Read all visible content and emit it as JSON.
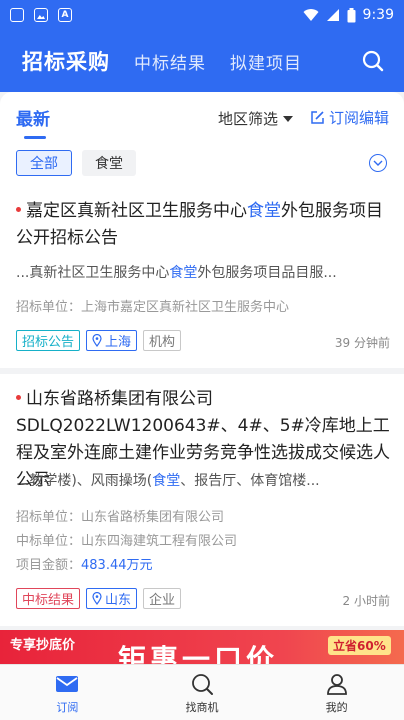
{
  "status_bar": {
    "time": "9:39",
    "icons": [
      "app-icon",
      "image-icon",
      "font-app-icon",
      "wifi-icon",
      "signal-icon",
      "battery-icon"
    ]
  },
  "header": {
    "tabs": [
      "招标采购",
      "中标结果",
      "拟建项目"
    ],
    "active_tab": "招标采购"
  },
  "filters": {
    "latest_label": "最新",
    "region_label": "地区筛选",
    "subscribe_edit_label": "订阅编辑",
    "chips": [
      "全部",
      "食堂"
    ],
    "active_chip": "全部"
  },
  "cards": [
    {
      "title_parts": [
        "嘉定区真新社区卫生服务中心",
        "食堂",
        "外包服务项目公开招标公告"
      ],
      "snippet_parts": [
        "...真新社区卫生服务中心",
        "食堂",
        "外包服务项目品目服..."
      ],
      "meta": [
        {
          "label": "招标单位：",
          "value": "上海市嘉定区真新社区卫生服务中心"
        }
      ],
      "tags": [
        "招标公告",
        "上海",
        "机构"
      ],
      "time": "39 分钟前"
    },
    {
      "title_parts": [
        "山东省路桥集团有限公司SDLQ2022LW1200643#、4#、5#冷库地上工程及室外连廊土建作业劳务竞争性选拔成交候选人公示"
      ],
      "snippet_parts": [
        "...教学楼)、风雨操场(",
        "食堂",
        "、报告厅、体育馆楼..."
      ],
      "meta": [
        {
          "label": "招标单位：",
          "value": "山东省路桥集团有限公司"
        },
        {
          "label": "中标单位：",
          "value": "山东四海建筑工程有限公司"
        },
        {
          "label": "项目金额：",
          "value": "483.44万元"
        }
      ],
      "tags": [
        "中标结果",
        "山东",
        "企业"
      ],
      "time": "2 小时前"
    }
  ],
  "banner": {
    "left_text": "专享抄底价",
    "main_text": "钜惠一口价",
    "badge": "立省60%"
  },
  "bottom_nav": {
    "items": [
      "订阅",
      "找商机",
      "我的"
    ],
    "active": "订阅"
  },
  "colors": {
    "primary": "#2f6bf2",
    "accent_red": "#e83b3b",
    "tag_cyan": "#16b0c8",
    "tag_red": "#e0465a"
  }
}
